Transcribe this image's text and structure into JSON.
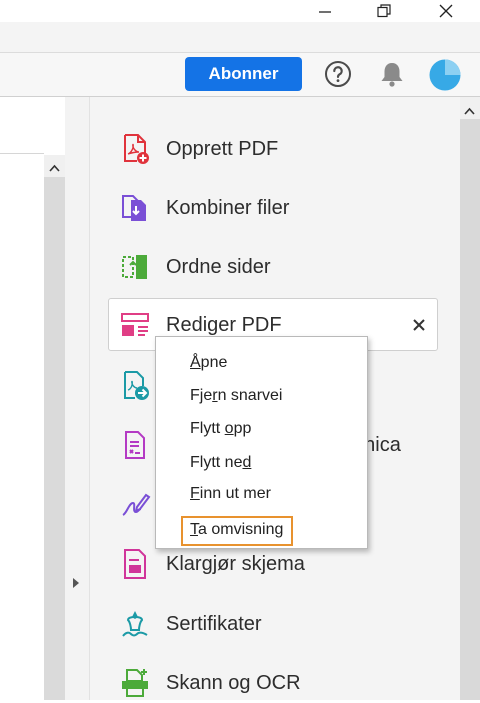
{
  "toolbar": {
    "subscribe_label": "Abonner"
  },
  "tools": [
    {
      "label": "Opprett PDF",
      "icon": "create-pdf-icon",
      "color": "#e0333c"
    },
    {
      "label": "Kombiner filer",
      "icon": "combine-files-icon",
      "color": "#7a4fd6"
    },
    {
      "label": "Ordne sider",
      "icon": "organize-pages-icon",
      "color": "#4caa3a"
    },
    {
      "label": "Rediger PDF",
      "icon": "edit-pdf-icon",
      "color": "#e03e85"
    },
    {
      "label": "",
      "icon": "export-pdf-icon",
      "color": "#1b9aa6"
    },
    {
      "label": "",
      "icon": "sign-doc-icon",
      "color": "#b43ac4"
    },
    {
      "label": "",
      "icon": "fill-sign-icon",
      "color": "#7a4fd6"
    },
    {
      "label": "Klargjør skjema",
      "icon": "prepare-form-icon",
      "color": "#d0359a"
    },
    {
      "label": "Sertifikater",
      "icon": "certificates-icon",
      "color": "#1b9aa6"
    },
    {
      "label": "Skann og OCR",
      "icon": "scan-ocr-icon",
      "color": "#4caa3a"
    }
  ],
  "partial_tool_text": "onica",
  "context_menu": {
    "items": [
      {
        "pre": "",
        "ul": "Å",
        "post": "pne"
      },
      {
        "pre": "Fje",
        "ul": "r",
        "post": "n snarvei"
      },
      {
        "pre": "Flytt ",
        "ul": "o",
        "post": "pp"
      },
      {
        "pre": "Flytt ne",
        "ul": "d",
        "post": ""
      },
      {
        "pre": "",
        "ul": "F",
        "post": "inn ut mer"
      },
      {
        "pre": "",
        "ul": "T",
        "post": "a omvisning"
      }
    ],
    "focused_index": 5
  },
  "colors": {
    "accent": "#1473e6",
    "focus": "#e8922e"
  }
}
